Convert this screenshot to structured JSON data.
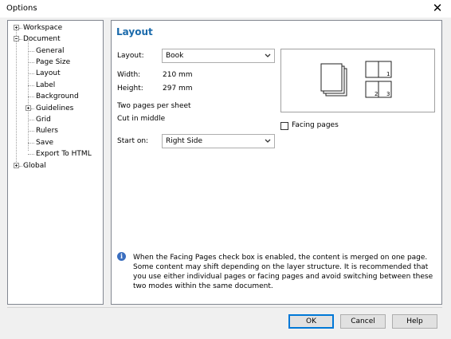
{
  "window": {
    "title": "Options",
    "close_glyph": "✕"
  },
  "tree": {
    "workspace": "Workspace",
    "document": "Document",
    "general": "General",
    "page_size": "Page Size",
    "layout": "Layout",
    "label": "Label",
    "background": "Background",
    "guidelines": "Guidelines",
    "grid": "Grid",
    "rulers": "Rulers",
    "save": "Save",
    "export_html": "Export To HTML",
    "global": "Global"
  },
  "panel": {
    "title": "Layout",
    "layout_label": "Layout:",
    "layout_value": "Book",
    "width_label": "Width:",
    "width_value": "210 mm",
    "height_label": "Height:",
    "height_value": "297 mm",
    "desc_line1": "Two pages per sheet",
    "desc_line2": "Cut in middle",
    "start_on_label": "Start on:",
    "start_on_value": "Right Side",
    "facing_pages_label": "Facing pages",
    "facing_pages_checked": false,
    "preview_numbers": [
      "1",
      "2",
      "3"
    ],
    "info_icon": "i",
    "info_text": "When the Facing Pages check box is enabled, the content is merged on one page. Some content may shift depending on the layer structure. It is recommended that you use either individual pages or facing pages and avoid switching between these two modes within the same document."
  },
  "buttons": {
    "ok": "OK",
    "cancel": "Cancel",
    "help": "Help"
  }
}
